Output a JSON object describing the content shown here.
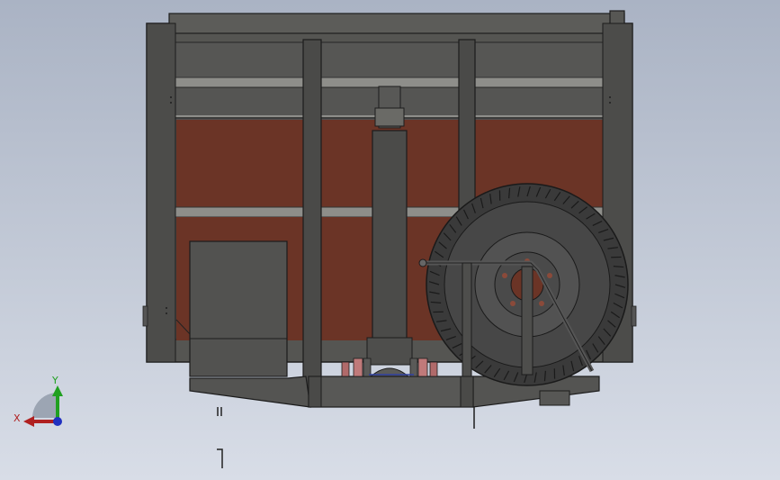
{
  "colors": {
    "frame": "#4f4f4d",
    "frame_dark": "#2e2e2e",
    "panel_red": "#6b3426",
    "grey_rail": "#8d8d88",
    "tire": "#3a3a3a",
    "wheel": "#4a4a4a",
    "background_top": "#aab3c4",
    "background_bottom": "#d8dde7",
    "axis_x": "#b02020",
    "axis_y": "#20a020",
    "axis_z": "#2030c0"
  },
  "triad": {
    "x_label": "X",
    "y_label": "Y"
  }
}
